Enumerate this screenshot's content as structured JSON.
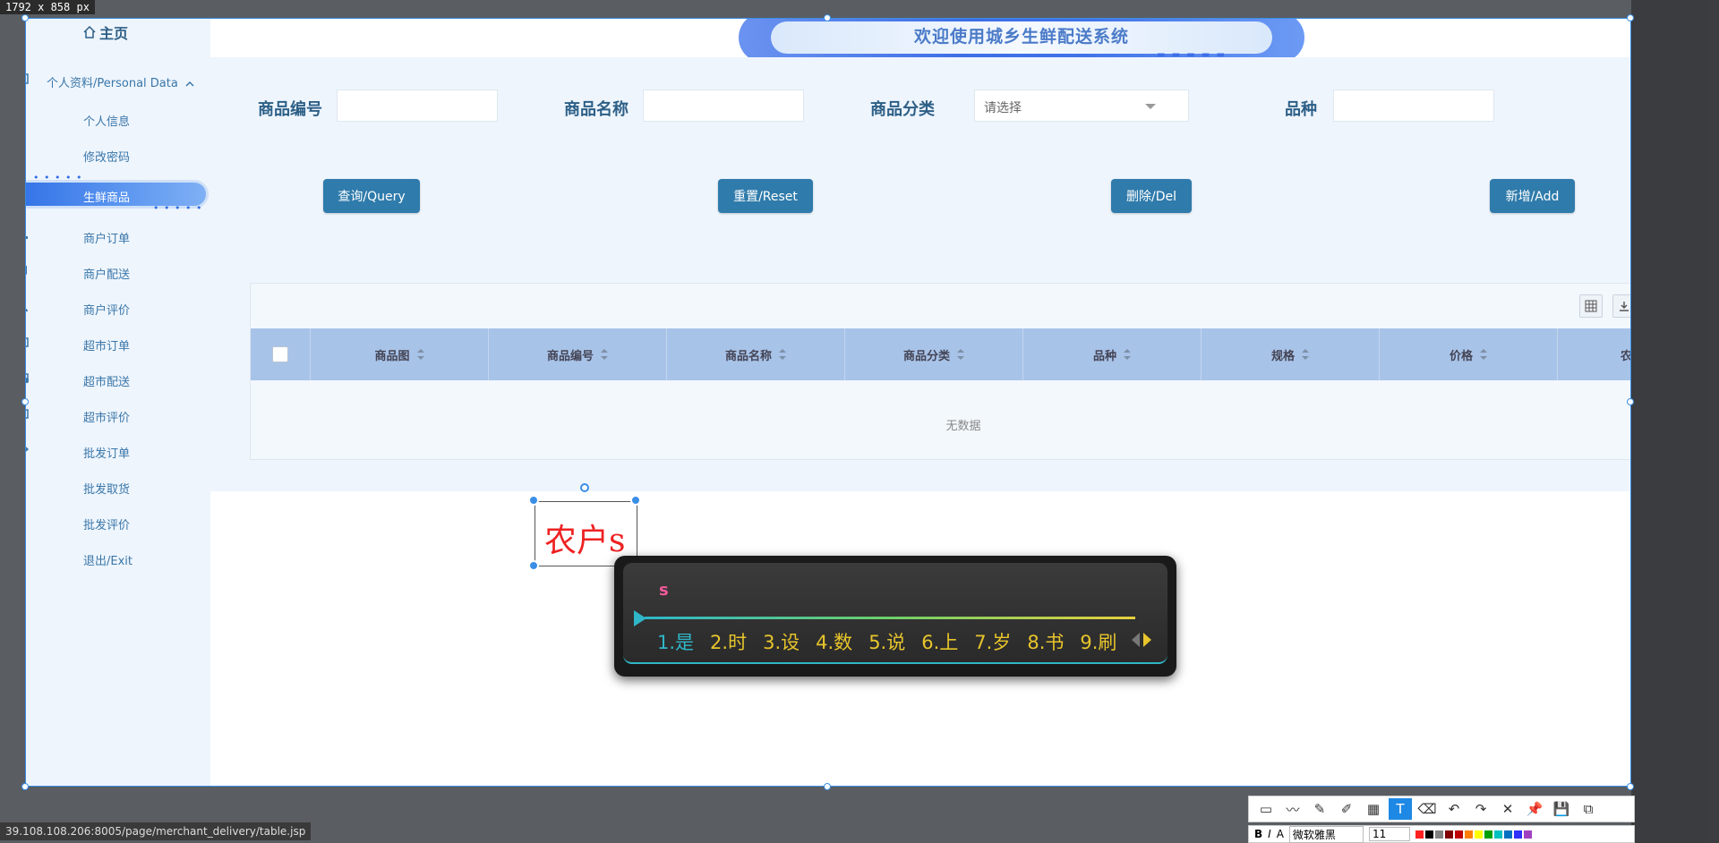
{
  "capture": {
    "dimensions_label": "1792 x 858   px"
  },
  "sidebar": {
    "home_label": "主页",
    "group_title": "个人资料/Personal Data",
    "items": [
      {
        "label": "个人信息"
      },
      {
        "label": "修改密码"
      },
      {
        "label": "生鲜商品",
        "active": true
      },
      {
        "label": "商户订单"
      },
      {
        "label": "商户配送"
      },
      {
        "label": "商户评价"
      },
      {
        "label": "超市订单"
      },
      {
        "label": "超市配送"
      },
      {
        "label": "超市评价"
      },
      {
        "label": "批发订单"
      },
      {
        "label": "批发取货"
      },
      {
        "label": "批发评价"
      },
      {
        "label": "退出/Exit"
      }
    ]
  },
  "header": {
    "title": "欢迎使用城乡生鲜配送系统"
  },
  "search": {
    "product_no_label": "商品编号",
    "product_name_label": "商品名称",
    "category_label": "商品分类",
    "category_placeholder": "请选择",
    "variety_label": "品种"
  },
  "buttons": {
    "query": "查询/Query",
    "reset": "重置/Reset",
    "delete": "删除/Del",
    "add": "新增/Add"
  },
  "table": {
    "columns": [
      "商品图",
      "商品编号",
      "商品名称",
      "商品分类",
      "品种",
      "规格",
      "价格",
      "农户用户"
    ],
    "empty_text": "无数据"
  },
  "annotation": {
    "text": "农户s"
  },
  "ime": {
    "input": "s",
    "candidates": [
      "1.是",
      "2.时",
      "3.设",
      "4.数",
      "5.说",
      "6.上",
      "7.岁",
      "8.书",
      "9.刷"
    ]
  },
  "statusbar": {
    "url": "39.108.108.206:8005/page/merchant_delivery/table.jsp"
  },
  "toolbar": {
    "font_name": "微软雅黑",
    "font_size": "11",
    "colors": [
      "#ff2020",
      "#000000",
      "#808080",
      "#800000",
      "#c00000",
      "#ff8000",
      "#ffff00",
      "#00a000",
      "#00c0c0",
      "#0070c0",
      "#3030ff",
      "#a040c0"
    ]
  },
  "icons": [
    "home-icon",
    "chevron-up-icon",
    "grid-icon",
    "export-icon",
    "print-icon"
  ]
}
